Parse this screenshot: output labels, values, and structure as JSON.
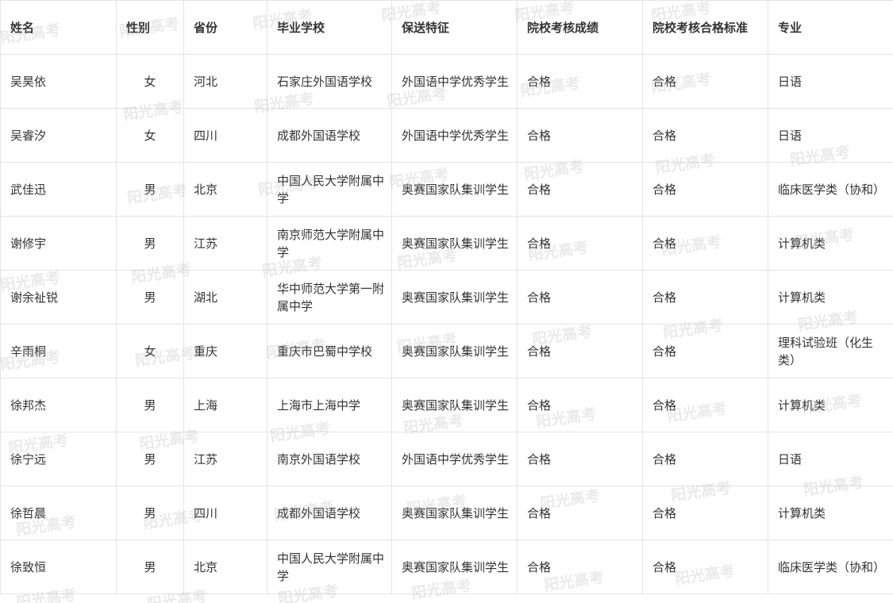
{
  "table": {
    "headers": [
      "姓名",
      "性别",
      "省份",
      "毕业学校",
      "保送特征",
      "院校考核成绩",
      "院校考核合格标准",
      "专业"
    ],
    "rows": [
      [
        "吴昊依",
        "女",
        "河北",
        "石家庄外国语学校",
        "外国语中学优秀学生",
        "合格",
        "合格",
        "日语"
      ],
      [
        "吴睿汐",
        "女",
        "四川",
        "成都外国语学校",
        "外国语中学优秀学生",
        "合格",
        "合格",
        "日语"
      ],
      [
        "武佳迅",
        "男",
        "北京",
        "中国人民大学附属中学",
        "奥赛国家队集训学生",
        "合格",
        "合格",
        "临床医学类（协和）"
      ],
      [
        "谢修宇",
        "男",
        "江苏",
        "南京师范大学附属中学",
        "奥赛国家队集训学生",
        "合格",
        "合格",
        "计算机类"
      ],
      [
        "谢余祉锐",
        "男",
        "湖北",
        "华中师范大学第一附属中学",
        "奥赛国家队集训学生",
        "合格",
        "合格",
        "计算机类"
      ],
      [
        "辛雨桐",
        "女",
        "重庆",
        "重庆市巴蜀中学校",
        "奥赛国家队集训学生",
        "合格",
        "合格",
        "理科试验班（化生类）"
      ],
      [
        "徐邦杰",
        "男",
        "上海",
        "上海市上海中学",
        "奥赛国家队集训学生",
        "合格",
        "合格",
        "计算机类"
      ],
      [
        "徐宁远",
        "男",
        "江苏",
        "南京外国语学校",
        "外国语中学优秀学生",
        "合格",
        "合格",
        "日语"
      ],
      [
        "徐哲晨",
        "男",
        "四川",
        "成都外国语学校",
        "奥赛国家队集训学生",
        "合格",
        "合格",
        "计算机类"
      ],
      [
        "徐致恒",
        "男",
        "北京",
        "中国人民大学附属中学",
        "奥赛国家队集训学生",
        "合格",
        "合格",
        "临床医学类（协和）"
      ]
    ]
  },
  "watermark": {
    "text": "阳光高考",
    "color": "#a0a0a0"
  }
}
